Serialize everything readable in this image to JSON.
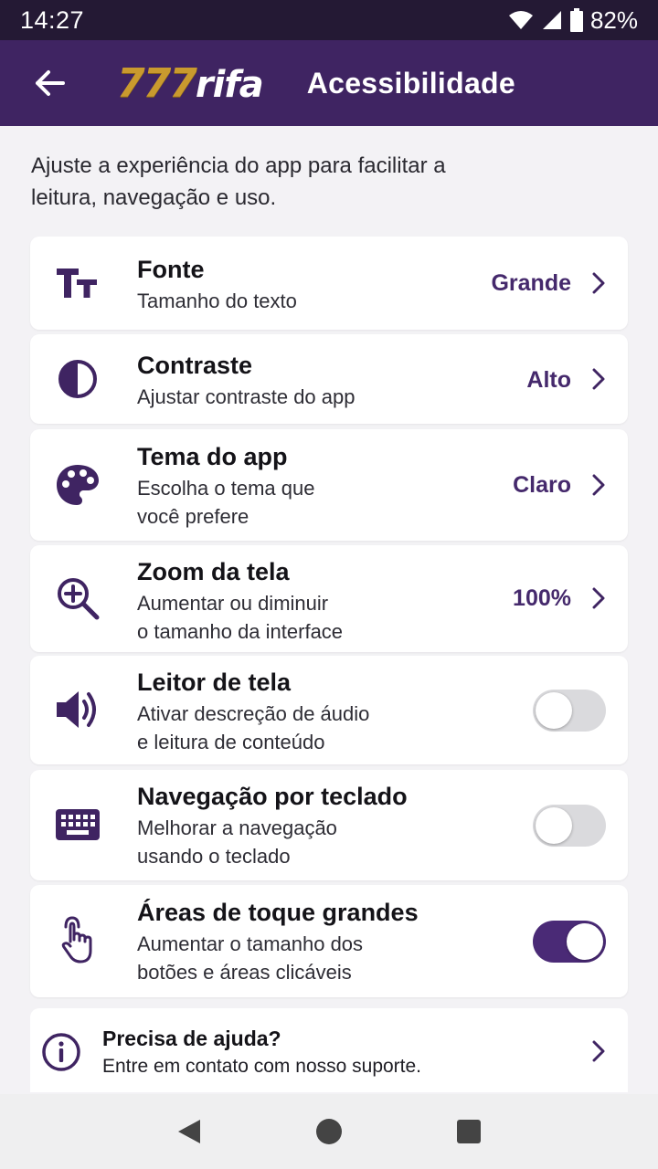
{
  "status": {
    "time": "14:27",
    "battery": "82%"
  },
  "app_bar": {
    "logo_number": "777",
    "logo_text": "rifa",
    "title": "Acessibilidade"
  },
  "intro": "Ajuste a experiência do app para facilitar a leitura, navegação e uso.",
  "settings": [
    {
      "title": "Fonte",
      "subtitle": "Tamanho do texto",
      "value": "Grande",
      "icon": "text-size-icon"
    },
    {
      "title": "Contraste",
      "subtitle": "Ajustar contraste do app",
      "value": "Alto",
      "icon": "contrast-icon"
    },
    {
      "title": "Tema do app",
      "subtitle_1": "Escolha o tema que",
      "subtitle_2": "você prefere",
      "value": "Claro",
      "icon": "palette-icon"
    },
    {
      "title": "Zoom da tela",
      "subtitle_1": "Aumentar ou diminuir",
      "subtitle_2": "o tamanho da interface",
      "value": "100%",
      "icon": "zoom-in-icon"
    },
    {
      "title": "Leitor de tela",
      "subtitle_1": "Ativar descreção de áudio",
      "subtitle_2": "e leitura de conteúdo",
      "enabled": false,
      "icon": "speaker-icon"
    },
    {
      "title": "Navegação por teclado",
      "subtitle_1": "Melhorar a navegação",
      "subtitle_2": "usando o teclado",
      "enabled": false,
      "icon": "keyboard-icon"
    },
    {
      "title": "Áreas de toque grandes",
      "subtitle_1": "Aumentar o tamanho dos",
      "subtitle_2": "botões e áreas clicáveis",
      "enabled": true,
      "icon": "touch-icon"
    }
  ],
  "help": {
    "title": "Precisa de ajuda?",
    "subtitle": "Entre em contato com nosso suporte.",
    "icon": "info-icon"
  },
  "colors": {
    "primary": "#3f2462",
    "status_bar": "#241934",
    "accent": "#45296c",
    "logo_gold": "#c99a2e"
  }
}
